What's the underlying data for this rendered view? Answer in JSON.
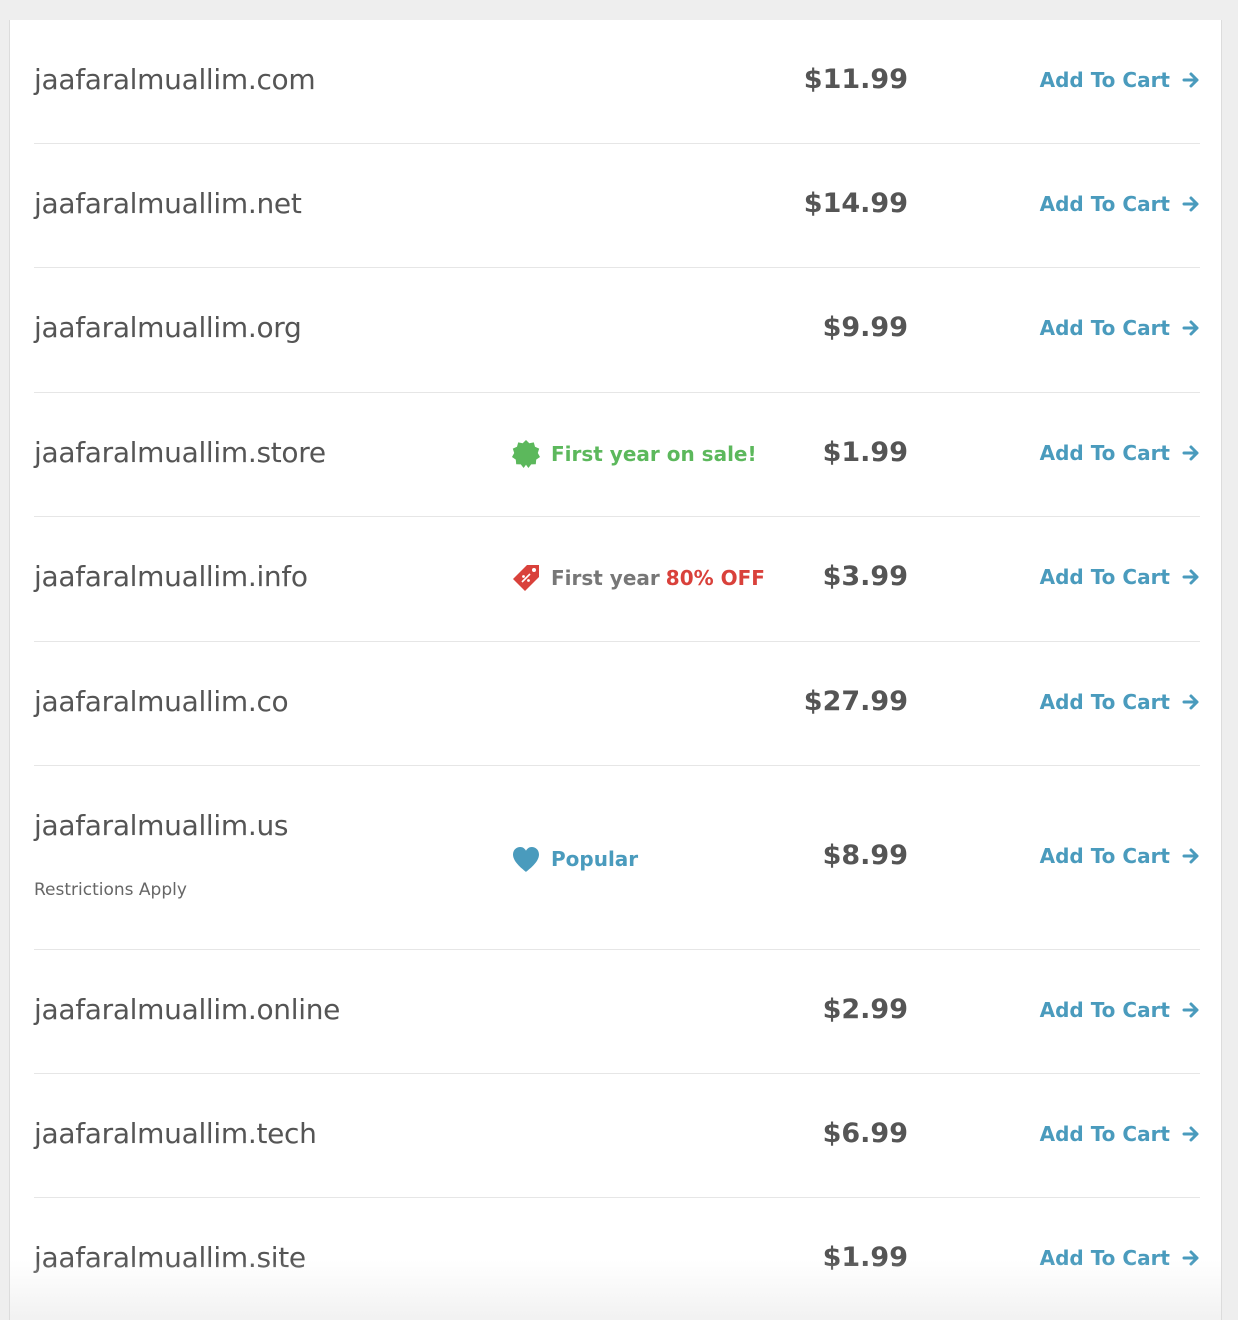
{
  "add_to_cart_label": "Add To Cart",
  "colors": {
    "link": "#4a9bbd",
    "sale": "#5cb85c",
    "discount": "#d9413b",
    "text": "#555555"
  },
  "rows": [
    {
      "domain": "jaafaralmuallim.com",
      "price": "$11.99"
    },
    {
      "domain": "jaafaralmuallim.net",
      "price": "$14.99"
    },
    {
      "domain": "jaafaralmuallim.org",
      "price": "$9.99"
    },
    {
      "domain": "jaafaralmuallim.store",
      "price": "$1.99",
      "badge": {
        "icon": "sale-seal-icon",
        "text": "First year on sale!"
      }
    },
    {
      "domain": "jaafaralmuallim.info",
      "price": "$3.99",
      "badge": {
        "icon": "discount-tag-icon",
        "text": "First year",
        "highlight": "80% OFF"
      }
    },
    {
      "domain": "jaafaralmuallim.co",
      "price": "$27.99"
    },
    {
      "domain": "jaafaralmuallim.us",
      "price": "$8.99",
      "note": "Restrictions Apply",
      "badge": {
        "icon": "heart-icon",
        "text": "Popular"
      }
    },
    {
      "domain": "jaafaralmuallim.online",
      "price": "$2.99"
    },
    {
      "domain": "jaafaralmuallim.tech",
      "price": "$6.99"
    },
    {
      "domain": "jaafaralmuallim.site",
      "price": "$1.99"
    }
  ]
}
